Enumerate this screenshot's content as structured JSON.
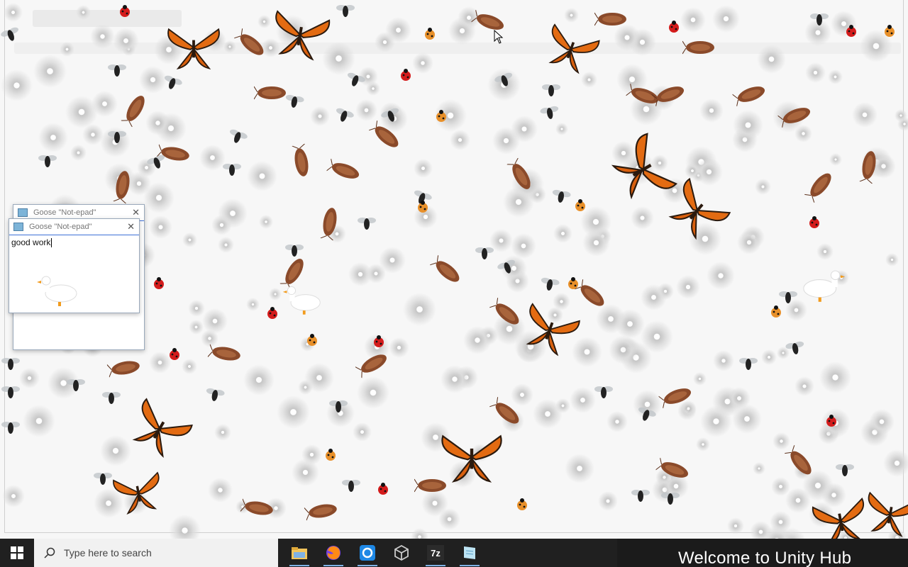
{
  "notepad_windows": [
    {
      "title": "Goose \"Not-epad\"",
      "text": ""
    },
    {
      "title": "Goose \"Not-epad\"",
      "text": "good work"
    }
  ],
  "taskbar": {
    "start_icon": "windows-logo-icon",
    "search_placeholder": "Type here to search",
    "apps": [
      {
        "name": "file-explorer-icon"
      },
      {
        "name": "firefox-icon"
      },
      {
        "name": "app-blue-ring-icon"
      },
      {
        "name": "unity-icon"
      },
      {
        "name": "7zip-icon",
        "label": "7z"
      },
      {
        "name": "notepad-icon"
      }
    ]
  },
  "unity_hub_banner": "Welcome to Unity Hub",
  "colors": {
    "taskbar": "#202020",
    "search_box": "#f1f1f1",
    "butterfly": "#e36b12",
    "accent": "#3d6fd6"
  }
}
